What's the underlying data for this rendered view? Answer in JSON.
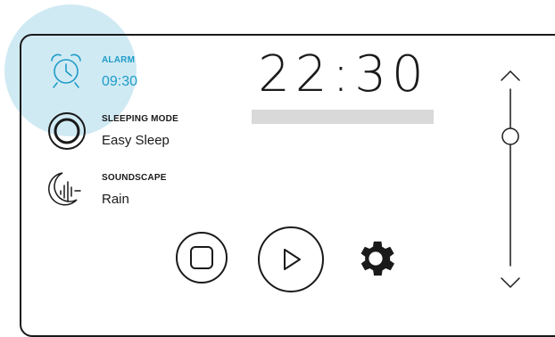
{
  "alarm": {
    "label": "ALARM",
    "time": "09:30"
  },
  "sleeping_mode": {
    "label": "SLEEPING MODE",
    "value": "Easy Sleep"
  },
  "soundscape": {
    "label": "SOUNDSCAPE",
    "value": "Rain"
  },
  "clock": {
    "time": "22:30"
  },
  "colors": {
    "accent": "#1e9cc7",
    "highlight": "#cbe8f3",
    "ink": "#1a1a1a",
    "bar": "#d9d9d9"
  },
  "controls": {
    "stop_icon": "stop-icon",
    "play_icon": "play-icon",
    "settings_icon": "gear-icon"
  },
  "slider": {
    "up_icon": "chevron-up-icon",
    "down_icon": "chevron-down-icon"
  }
}
